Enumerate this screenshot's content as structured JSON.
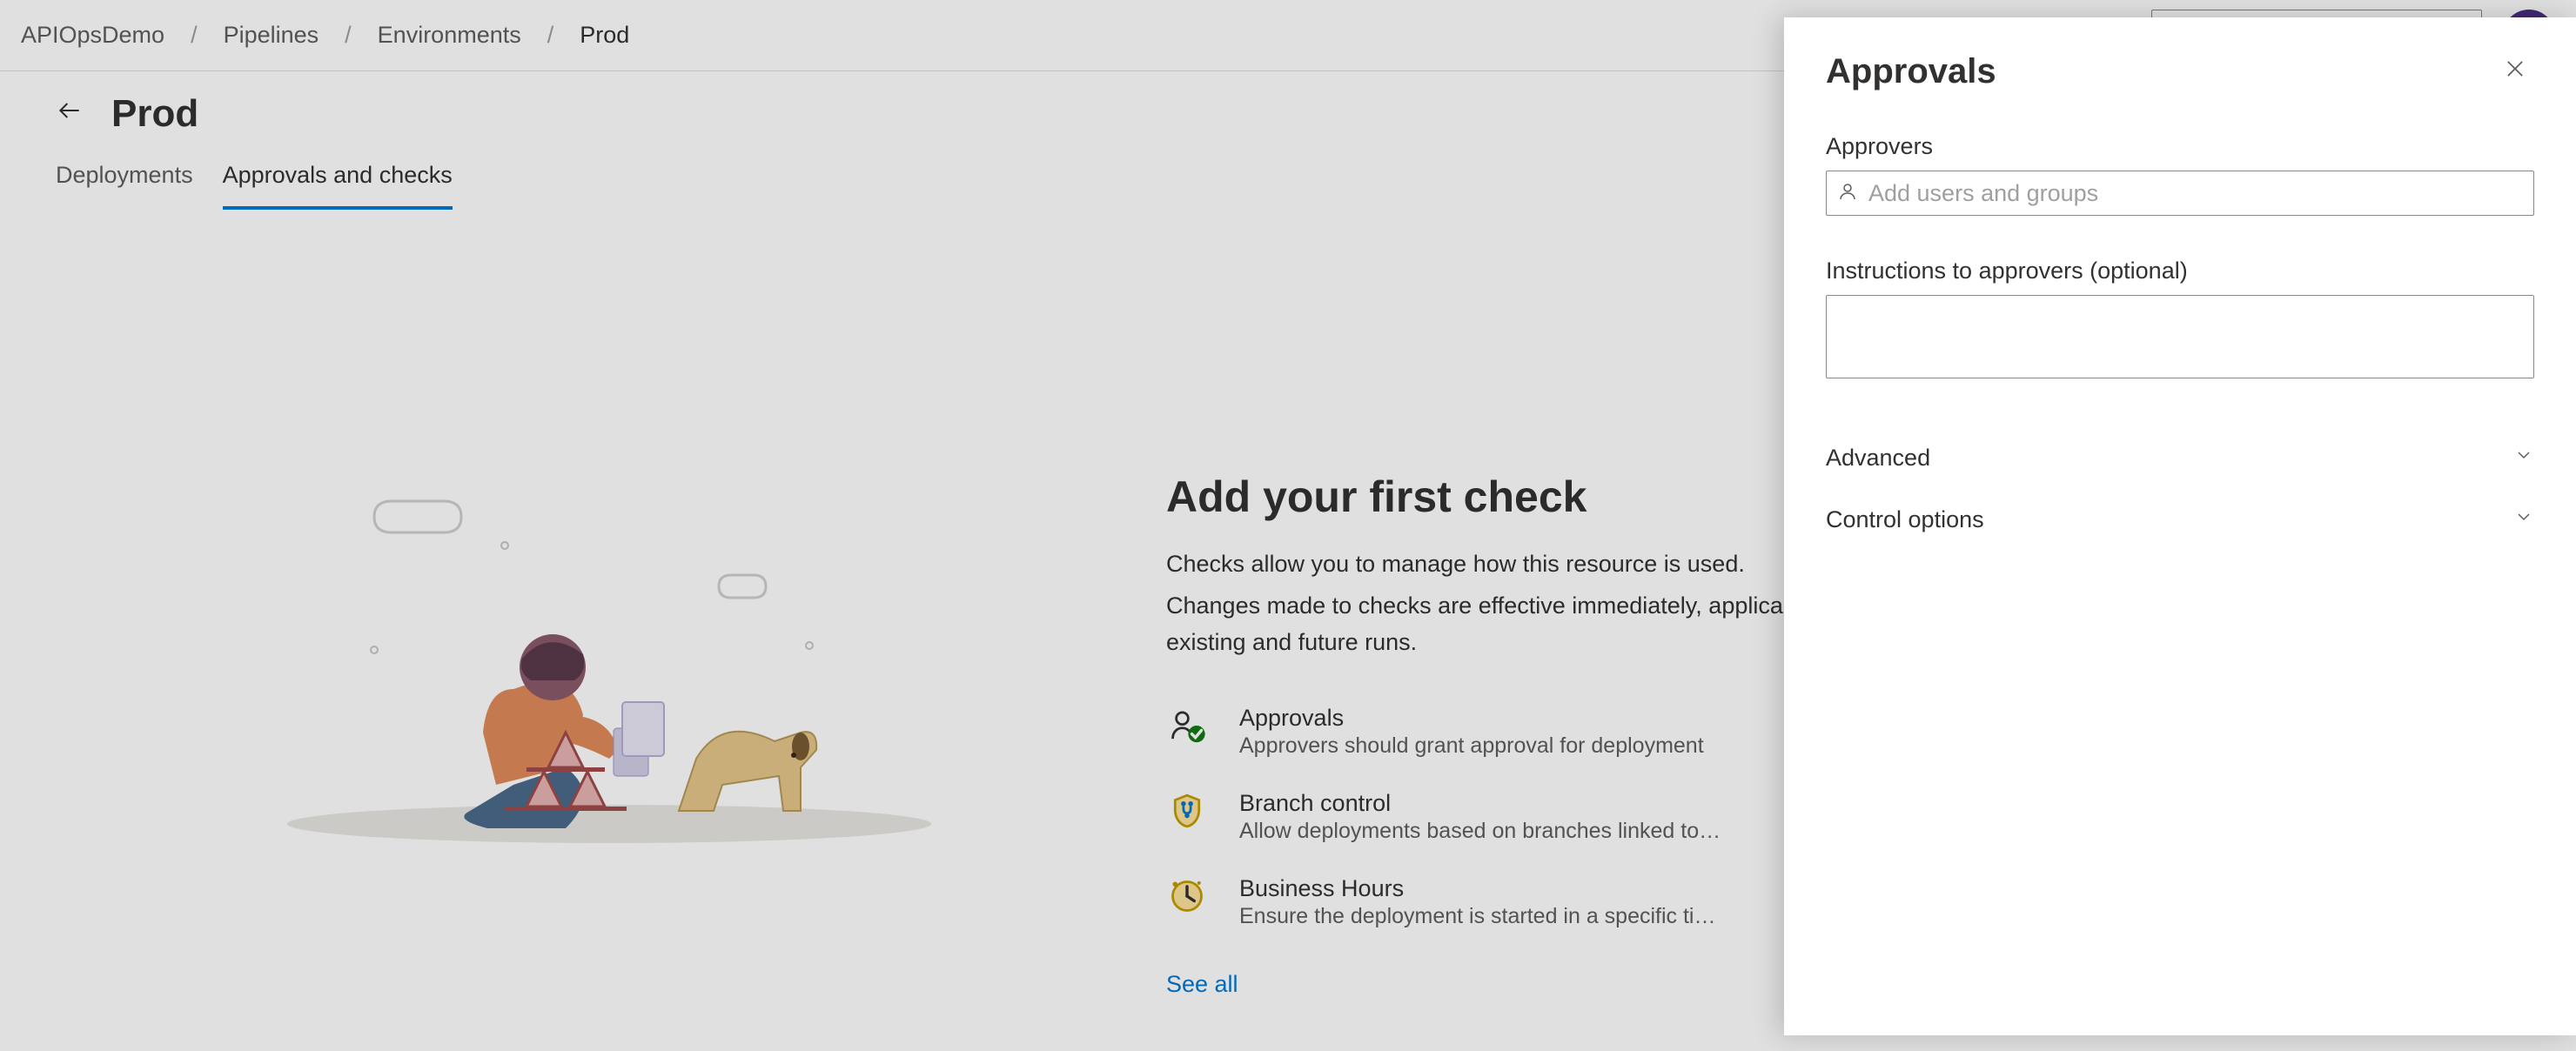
{
  "breadcrumbs": {
    "items": [
      "APIOpsDemo",
      "Pipelines",
      "Environments",
      "Prod"
    ]
  },
  "page": {
    "title": "Prod"
  },
  "tabs": {
    "deployments": "Deployments",
    "approvals": "Approvals and checks"
  },
  "empty": {
    "title": "Add your first check",
    "line1": "Checks allow you to manage how this resource is used.",
    "line2": "Changes made to checks are effective immediately, applicable to all existing and future runs.",
    "checks": {
      "approvals": {
        "title": "Approvals",
        "sub": "Approvers should grant approval for deployment"
      },
      "branch": {
        "title": "Branch control",
        "sub": "Allow deployments based on branches linked to the run"
      },
      "hours": {
        "title": "Business Hours",
        "sub": "Ensure the deployment is started in a specific time window"
      }
    },
    "see_all": "See all"
  },
  "panel": {
    "title": "Approvals",
    "approvers_label": "Approvers",
    "approvers_placeholder": "Add users and groups",
    "instructions_label": "Instructions to approvers (optional)",
    "advanced": "Advanced",
    "control_options": "Control options"
  }
}
